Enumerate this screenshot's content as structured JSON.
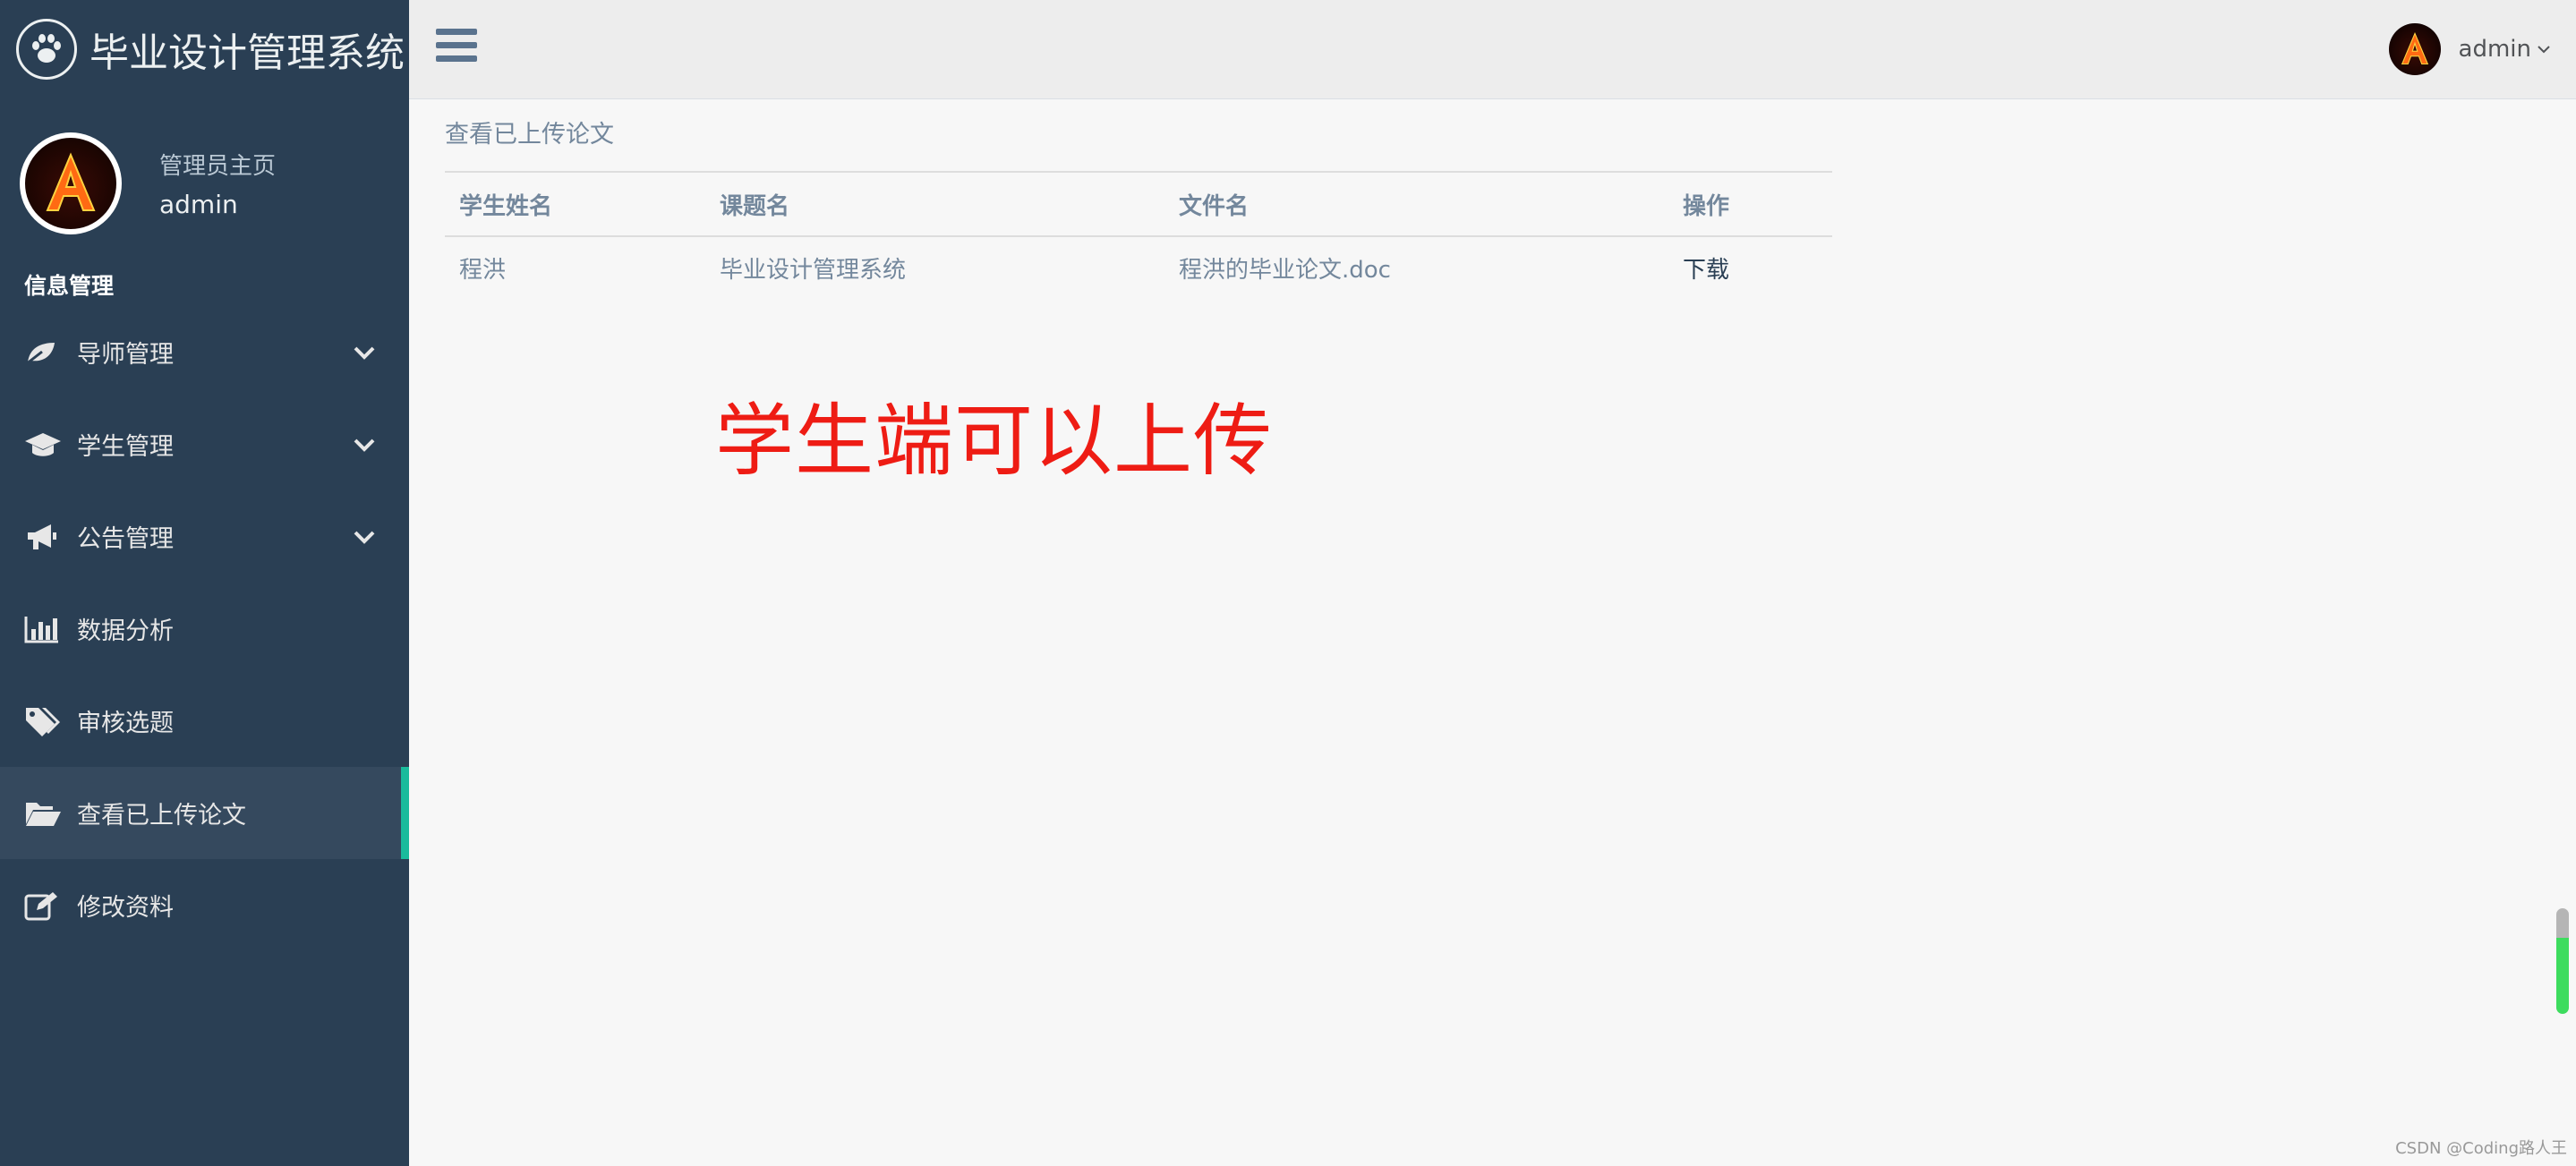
{
  "brand": {
    "title": "毕业设计管理系统",
    "icon": "paw-icon"
  },
  "profile": {
    "welcome": "管理员主页",
    "name": "admin"
  },
  "sidebar": {
    "section_title": "信息管理",
    "items": [
      {
        "label": "导师管理",
        "icon": "leaf-icon",
        "has_submenu": true
      },
      {
        "label": "学生管理",
        "icon": "graduation-cap-icon",
        "has_submenu": true
      },
      {
        "label": "公告管理",
        "icon": "bullhorn-icon",
        "has_submenu": true
      },
      {
        "label": "数据分析",
        "icon": "bar-chart-icon",
        "has_submenu": false
      },
      {
        "label": "审核选题",
        "icon": "tags-icon",
        "has_submenu": false
      },
      {
        "label": "查看已上传论文",
        "icon": "folder-open-icon",
        "has_submenu": false,
        "active": true
      },
      {
        "label": "修改资料",
        "icon": "edit-icon",
        "has_submenu": false
      }
    ]
  },
  "topbar": {
    "user_name": "admin"
  },
  "main": {
    "page_title": "查看已上传论文",
    "table": {
      "headers": [
        "学生姓名",
        "课题名",
        "文件名",
        "操作"
      ],
      "rows": [
        {
          "student": "程洪",
          "topic": "毕业设计管理系统",
          "file": "程洪的毕业论文.doc",
          "action": "下载"
        }
      ]
    }
  },
  "annotation": "学生端可以上传",
  "watermark": "CSDN @Coding路人王",
  "colors": {
    "sidebar": "#2a3f54",
    "accent": "#1abb9c",
    "annotation": "#ee1c14"
  }
}
